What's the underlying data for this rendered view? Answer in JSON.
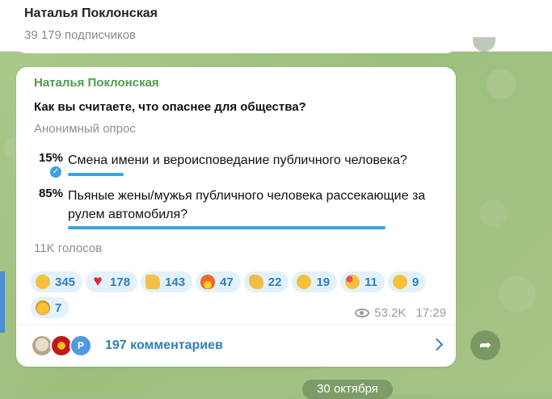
{
  "channel": {
    "title": "Наталья Поклонская",
    "subscribers": "39 179 подписчиков"
  },
  "post": {
    "author": "Наталья Поклонская",
    "question": "Как вы считаете, что опаснее для общества?",
    "poll_type": "Анонимный опрос",
    "options": [
      {
        "percent": "15%",
        "text": "Смена имени и вероисповедание публичного человека?",
        "share": 0.15,
        "chosen": true
      },
      {
        "percent": "85%",
        "text": "Пьяные жены/мужья публичного человека рассекающие за рулем автомобиля?",
        "share": 0.85,
        "chosen": false
      }
    ],
    "votes": "11K голосов",
    "reactions": [
      {
        "emoji": "grinning-face",
        "count": "345"
      },
      {
        "emoji": "red-heart",
        "count": "178"
      },
      {
        "emoji": "thumbs-up",
        "count": "143"
      },
      {
        "emoji": "fire",
        "count": "47"
      },
      {
        "emoji": "clapping-hands",
        "count": "22"
      },
      {
        "emoji": "thinking-face",
        "count": "19"
      },
      {
        "emoji": "smiling-face-with-hearts",
        "count": "11"
      },
      {
        "emoji": "hugging-face",
        "count": "9"
      },
      {
        "emoji": "star-struck",
        "count": "7"
      }
    ],
    "views": "53.2K",
    "time": "17:29",
    "comments": {
      "label": "197 комментариев",
      "avatar_letter": "P"
    }
  },
  "date_badge": "30 октября",
  "colors": {
    "accent": "#3ea2de",
    "author": "#4aa04a",
    "link": "#2f7fbf",
    "background": "#9fbf84"
  }
}
